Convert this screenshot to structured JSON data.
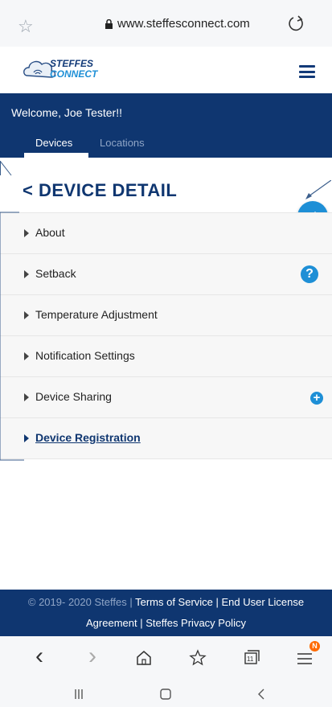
{
  "browser": {
    "url": "www.steffesconnect.com",
    "favorite_icon": "star-outline-icon",
    "reload_icon": "reload-icon"
  },
  "app": {
    "brand_line1": "STEFFES",
    "brand_line2": "CONNECT",
    "welcome": "Welcome, Joe Tester!!",
    "tabs": [
      {
        "label": "Devices",
        "active": true
      },
      {
        "label": "Locations",
        "active": false
      }
    ]
  },
  "detail": {
    "title": "< DEVICE DETAIL",
    "items": [
      {
        "label": "About"
      },
      {
        "label": "Setback"
      },
      {
        "label": "Temperature Adjustment"
      },
      {
        "label": "Notification Settings"
      },
      {
        "label": "Device Sharing"
      },
      {
        "label": "Device Registration"
      }
    ],
    "help_symbol": "?",
    "add_symbol": "+"
  },
  "footer": {
    "copyright": "© 2019- 2020 Steffes |",
    "terms": "Terms of Service | End User License",
    "line2": "Agreement | Steffes Privacy Policy"
  },
  "browser_nav": {
    "back": "‹",
    "forward": "›",
    "tabs_count": "11",
    "badge": "N"
  },
  "colors": {
    "navy": "#0f3670",
    "accent": "#1e8fd6"
  }
}
